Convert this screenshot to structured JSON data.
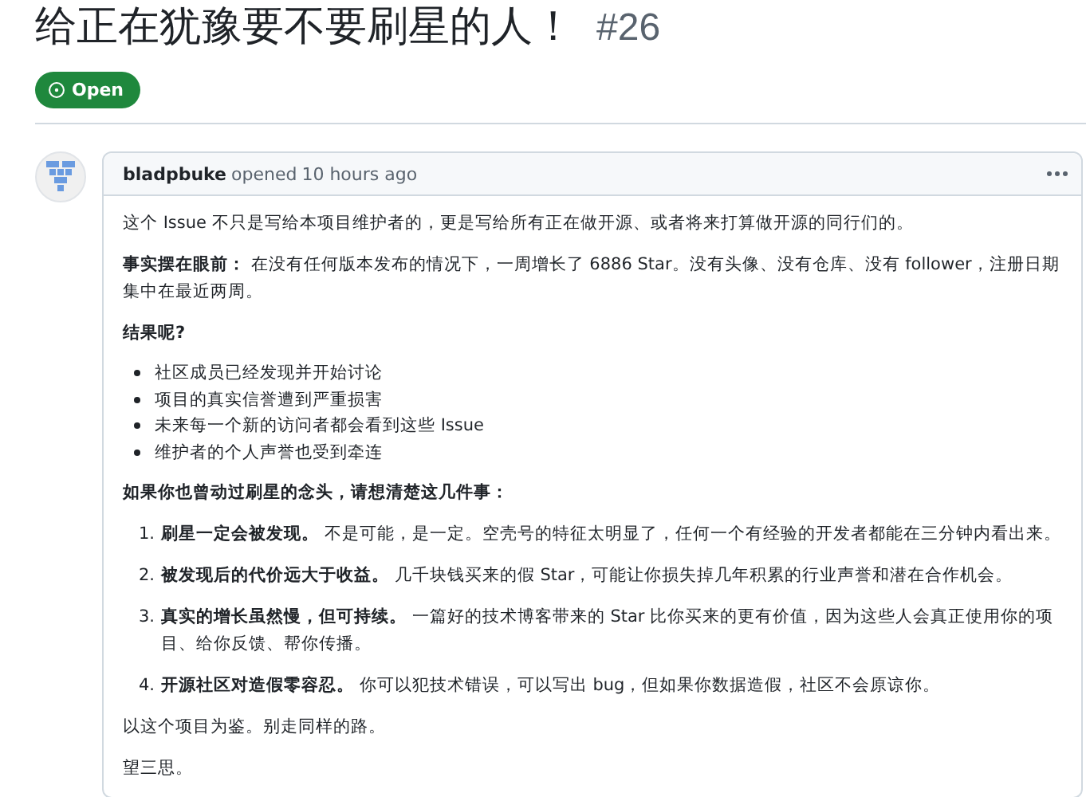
{
  "issue": {
    "title": "给正在犹豫要不要刷星的人！",
    "number": "#26",
    "status": {
      "open": true,
      "label": "Open"
    }
  },
  "comment": {
    "author": "bladpbuke",
    "action": "opened",
    "time": "10 hours ago",
    "body": [
      {
        "kind": "paragraph",
        "text": "这个 Issue 不只是写给本项目维护者的，更是写给所有正在做开源、或者将来打算做开源的同行们的。"
      },
      {
        "kind": "paragraph",
        "text": "**事实摆在眼前：** 在没有任何版本发布的情况下，一周增长了 6886 Star。没有头像、没有仓库、没有 follower，注册日期集中在最近两周。"
      },
      {
        "kind": "heading",
        "text": "结果呢?"
      },
      {
        "kind": "bullets",
        "items": [
          "社区成员已经发现并开始讨论",
          "项目的真实信誉遭到严重损害",
          "未来每一个新的访问者都会看到这些 Issue",
          "维护者的个人声誉也受到牵连"
        ]
      },
      {
        "kind": "heading",
        "text": "如果你也曾动过刷星的念头，请想清楚这几件事："
      },
      {
        "kind": "numbered",
        "items": [
          {
            "number": "1.",
            "text": "**刷星一定会被发现。** 不是可能，是一定。空壳号的特征太明显了，任何一个有经验的开发者都能在三分钟内看出来。"
          },
          {
            "number": "2.",
            "text": "**被发现后的代价远大于收益。** 几千块钱买来的假 Star，可能让你损失掉几年积累的行业声誉和潜在合作机会。"
          },
          {
            "number": "3.",
            "text": "**真实的增长虽然慢，但可持续。** 一篇好的技术博客带来的 Star 比你买来的更有价值，因为这些人会真正使用你的项目、给你反馈、帮你传播。"
          },
          {
            "number": "4.",
            "text": "**开源社区对造假零容忍。** 你可以犯技术错误，可以写出 bug，但如果你数据造假，社区不会原谅你。"
          }
        ]
      },
      {
        "kind": "paragraph",
        "text": "以这个项目为鉴。别走同样的路。"
      },
      {
        "kind": "paragraph",
        "text": "望三思。"
      }
    ]
  }
}
